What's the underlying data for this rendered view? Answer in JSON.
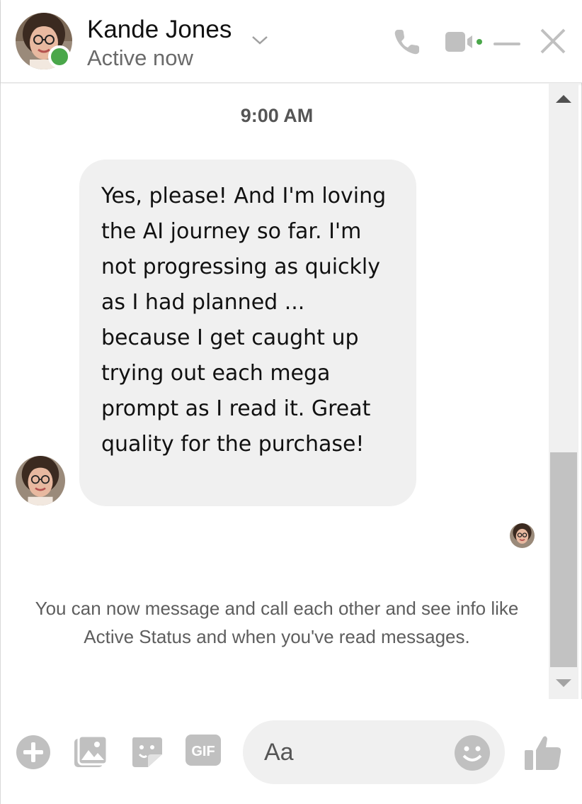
{
  "header": {
    "contact_name": "Kande Jones",
    "status": "Active now",
    "presence_color": "#4aa74a",
    "icons": [
      "chevron-down-icon",
      "phone-icon",
      "video-camera-icon",
      "minimize-icon",
      "close-icon"
    ]
  },
  "conversation": {
    "timestamp": "9:00 AM",
    "messages": [
      {
        "sender": "Kande Jones",
        "direction": "incoming",
        "text": "Yes, please! And I'm loving the AI journey so far. I'm not progressing as quickly as I had planned ... because I get caught up trying out each mega prompt as I read it. Great quality for the purchase!"
      }
    ],
    "system_note": "You can now message and call each other and see info like Active Status and when you've read messages."
  },
  "composer": {
    "placeholder": "Aa",
    "icons": [
      "plus-icon",
      "photo-icon",
      "sticker-icon",
      "gif-icon",
      "emoji-icon",
      "thumbs-up-icon"
    ],
    "gif_label": "GIF"
  },
  "colors": {
    "icon_gray": "#c0c0c0",
    "bubble_bg": "#f0f0f0",
    "text": "#111111"
  }
}
